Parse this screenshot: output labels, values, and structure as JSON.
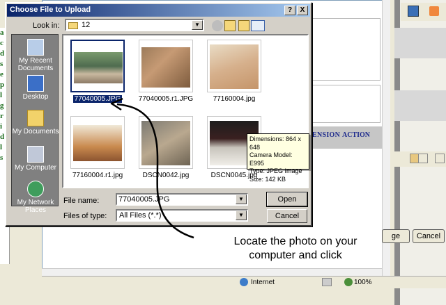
{
  "background_app": {
    "sidebar_letters": [
      "a",
      "c",
      "d",
      "s",
      "e",
      "p",
      "l",
      "g",
      "r",
      "i",
      "d",
      "l",
      "s"
    ],
    "band_text_1": "ENSION",
    "band_text_2": "ACTION",
    "change_button": "ge",
    "cancel_button": "Cancel",
    "status_zone": "Internet",
    "zoom": "100%"
  },
  "dialog": {
    "title": "Choose File to Upload",
    "help_label": "?",
    "close_label": "X",
    "look_in_label": "Look in:",
    "look_in_value": "12",
    "places": [
      {
        "label": "My Recent Documents",
        "icon": "recent-documents-icon"
      },
      {
        "label": "Desktop",
        "icon": "desktop-icon"
      },
      {
        "label": "My Documents",
        "icon": "my-documents-icon"
      },
      {
        "label": "My Computer",
        "icon": "my-computer-icon"
      },
      {
        "label": "My Network Places",
        "icon": "network-places-icon"
      }
    ],
    "files": [
      {
        "name": "77040005.JPG",
        "selected": true
      },
      {
        "name": "77040005.r1.JPG",
        "selected": false
      },
      {
        "name": "77160004.jpg",
        "selected": false
      },
      {
        "name": "77160004.r1.jpg",
        "selected": false
      },
      {
        "name": "DSCN0042.jpg",
        "selected": false
      },
      {
        "name": "DSCN0045.jpg",
        "selected": false
      }
    ],
    "tooltip": {
      "dimensions": "Dimensions: 864 x 648",
      "camera": "Camera Model: E995",
      "type": "Type: JPEG Image",
      "size": "Size: 142 KB"
    },
    "file_name_label": "File name:",
    "file_name_value": "77040005.JPG",
    "file_type_label": "Files of type:",
    "file_type_value": "All Files (*.*)",
    "open_button": "Open",
    "cancel_button": "Cancel"
  },
  "annotation": {
    "line1": "Locate the photo on your",
    "line2": "computer and click"
  },
  "colors": {
    "title_bar": "#0a246a",
    "selection": "#0a246a",
    "tooltip_bg": "#ffffe1",
    "band_text": "#1d2a8c"
  }
}
